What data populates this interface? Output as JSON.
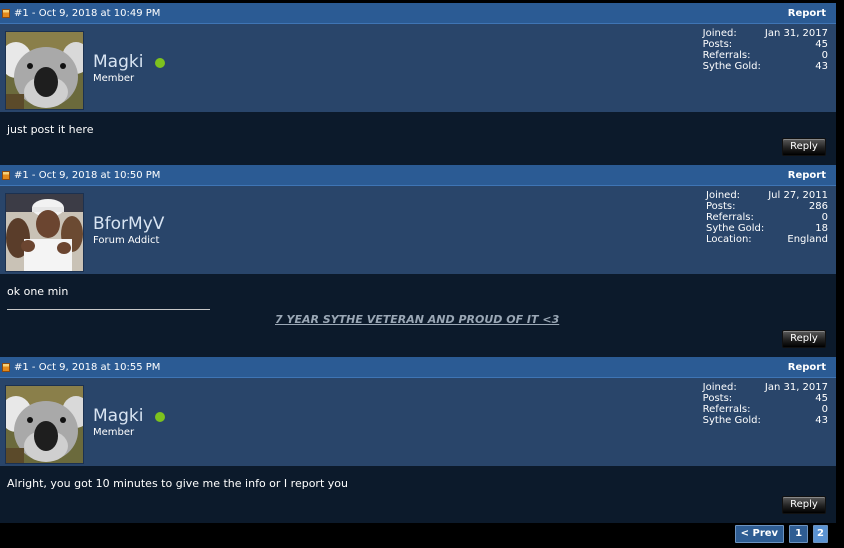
{
  "posts": [
    {
      "meta": "#1 - Oct 9, 2018 at 10:49 PM",
      "report": "Report",
      "username": "Magki",
      "online": true,
      "avatar": "koala-avatar",
      "title": "Member",
      "stats": [
        {
          "label": "Joined:",
          "value": "Jan 31, 2017"
        },
        {
          "label": "Posts:",
          "value": "45"
        },
        {
          "label": "Referrals:",
          "value": "0"
        },
        {
          "label": "Sythe Gold:",
          "value": "43"
        }
      ],
      "message": "just post it here",
      "reply": "Reply"
    },
    {
      "meta": "#1 - Oct 9, 2018 at 10:50 PM",
      "report": "Report",
      "username": "BforMyV",
      "online": false,
      "avatar": "man-white-cap-avatar",
      "title": "Forum Addict",
      "stats": [
        {
          "label": "Joined:",
          "value": "Jul 27, 2011"
        },
        {
          "label": "Posts:",
          "value": "286"
        },
        {
          "label": "Referrals:",
          "value": "0"
        },
        {
          "label": "Sythe Gold:",
          "value": "18"
        },
        {
          "label": "Location:",
          "value": "England"
        }
      ],
      "message": "ok one min",
      "signature": "7 YEAR SYTHE VETERAN AND PROUD OF IT <3",
      "reply": "Reply"
    },
    {
      "meta": "#1 - Oct 9, 2018 at 10:55 PM",
      "report": "Report",
      "username": "Magki",
      "online": true,
      "avatar": "koala-avatar",
      "title": "Member",
      "stats": [
        {
          "label": "Joined:",
          "value": "Jan 31, 2017"
        },
        {
          "label": "Posts:",
          "value": "45"
        },
        {
          "label": "Referrals:",
          "value": "0"
        },
        {
          "label": "Sythe Gold:",
          "value": "43"
        }
      ],
      "message": "Alright, you got 10 minutes to give me the info or I report you",
      "reply": "Reply"
    }
  ],
  "pagination": {
    "prev": "< Prev",
    "pages": [
      "1",
      "2"
    ],
    "current": "2"
  },
  "colors": {
    "header": "#2b5b94",
    "user_panel": "#29456a",
    "body": "#0c1a2b",
    "online": "#7dc21e"
  }
}
